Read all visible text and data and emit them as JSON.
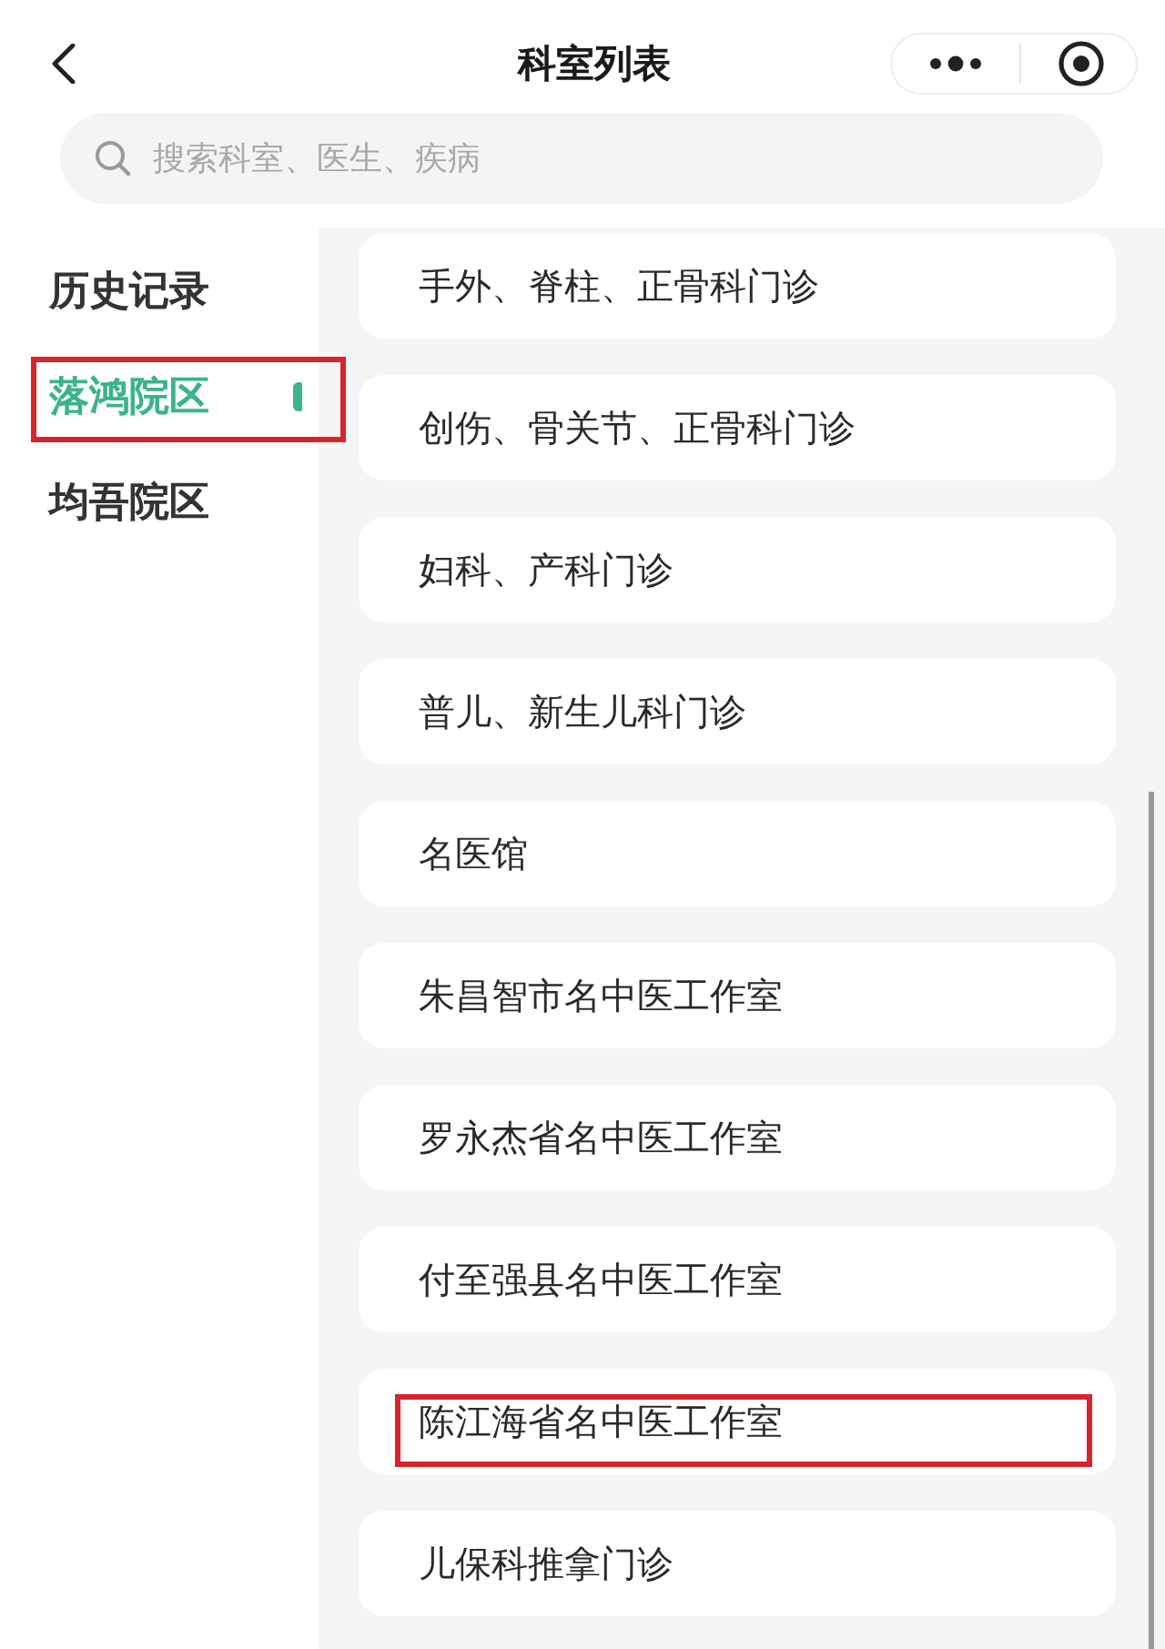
{
  "nav_bar": {
    "title": "科室列表"
  },
  "search": {
    "placeholder": "搜索科室、医生、疾病"
  },
  "sidebar": {
    "items": [
      {
        "label": "历史记录",
        "selected": false,
        "highlighted": false
      },
      {
        "label": "落鸿院区",
        "selected": true,
        "highlighted": true
      },
      {
        "label": "均吾院区",
        "selected": false,
        "highlighted": false
      }
    ]
  },
  "departments": [
    {
      "name": "手外、脊柱、正骨科门诊",
      "highlighted": false
    },
    {
      "name": "创伤、骨关节、正骨科门诊",
      "highlighted": false
    },
    {
      "name": "妇科、产科门诊",
      "highlighted": false
    },
    {
      "name": "普儿、新生儿科门诊",
      "highlighted": false
    },
    {
      "name": "名医馆",
      "highlighted": false
    },
    {
      "name": "朱昌智市名中医工作室",
      "highlighted": false
    },
    {
      "name": "罗永杰省名中医工作室",
      "highlighted": false
    },
    {
      "name": "付至强县名中医工作室",
      "highlighted": false
    },
    {
      "name": "陈江海省名中医工作室",
      "highlighted": true
    },
    {
      "name": "儿保科推拿门诊",
      "highlighted": false
    }
  ]
}
